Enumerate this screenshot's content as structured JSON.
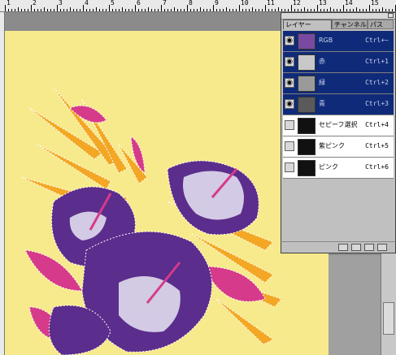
{
  "ruler": {
    "labels": [
      "1",
      "2",
      "3",
      "4",
      "5",
      "6",
      "7",
      "8",
      "9",
      "10",
      "11",
      "12",
      "13",
      "14",
      "15"
    ]
  },
  "layers_panel": {
    "tabs": [
      "レイヤー",
      "チャンネル",
      "パス"
    ],
    "channels": [
      {
        "name": "RGB",
        "shortcut": "Ctrl+~",
        "selected": true,
        "visible": true,
        "thumb_color": "#7a4aa0"
      },
      {
        "name": "赤",
        "shortcut": "Ctrl+1",
        "selected": true,
        "visible": true,
        "thumb_color": "#c8c8c8"
      },
      {
        "name": "緑",
        "shortcut": "Ctrl+2",
        "selected": true,
        "visible": true,
        "thumb_color": "#9a9a9a"
      },
      {
        "name": "青",
        "shortcut": "Ctrl+3",
        "selected": true,
        "visible": true,
        "thumb_color": "#5a5a5a"
      },
      {
        "name": "セピーフ選択",
        "shortcut": "Ctrl+4",
        "selected": false,
        "visible": false,
        "thumb_color": "#111111"
      },
      {
        "name": "紫ピンク",
        "shortcut": "Ctrl+5",
        "selected": false,
        "visible": false,
        "thumb_color": "#111111"
      },
      {
        "name": "ピンク",
        "shortcut": "Ctrl+6",
        "selected": false,
        "visible": false,
        "thumb_color": "#111111"
      }
    ],
    "eye_icon": "eye-icon"
  },
  "colors": {
    "background": "#f7ea8d",
    "selection": "#0f2a78",
    "purple": "#5b2d8c",
    "pink": "#d63a8a",
    "orange": "#f3a724"
  }
}
